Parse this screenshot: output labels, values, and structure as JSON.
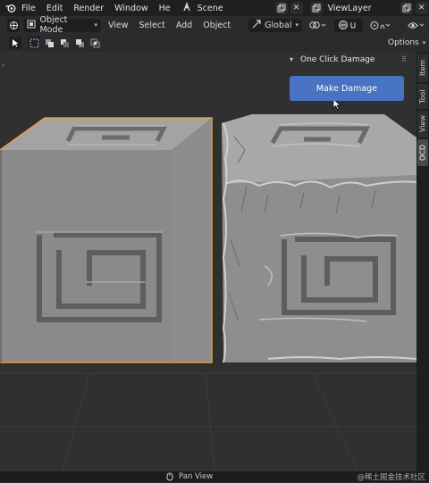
{
  "topbar": {
    "menus": [
      "File",
      "Edit",
      "Render",
      "Window",
      "He"
    ],
    "scene": "Scene",
    "view_layer": "ViewLayer"
  },
  "header": {
    "mode": "Object Mode",
    "menus": [
      "View",
      "Select",
      "Add",
      "Object"
    ],
    "orientation": "Global",
    "options": "Options"
  },
  "side_tabs": [
    "Item",
    "Tool",
    "View",
    "OCD"
  ],
  "panel": {
    "title": "One Click Damage",
    "button": "Make Damage"
  },
  "statusbar": {
    "action": "Pan View",
    "watermark": "@稀土掘金技术社区"
  },
  "colors": {
    "accent_blue": "#4773c2",
    "selection_outline": "#e89a3c",
    "blender_logo": "#e87d0d"
  }
}
